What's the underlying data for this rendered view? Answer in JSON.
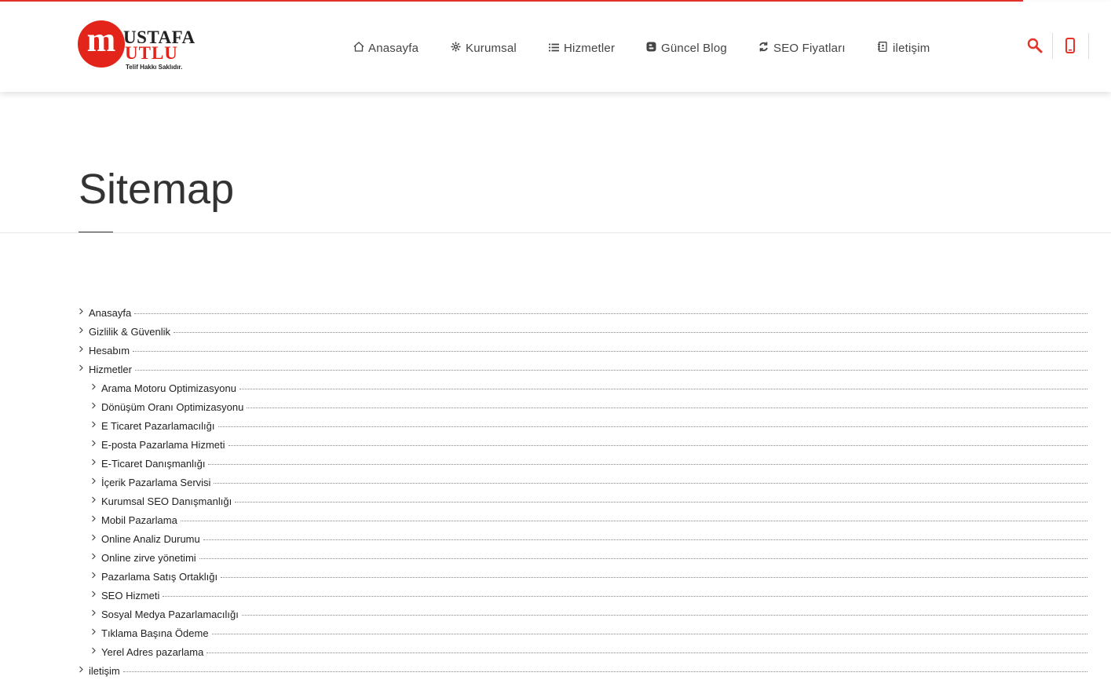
{
  "logo": {
    "mark_letter": "m",
    "name_top": "USTAFA",
    "name_bottom": "UTLU",
    "tagline": "Telif Hakkı Saklıdır."
  },
  "nav": [
    {
      "label": "Anasayfa",
      "icon": "home-icon"
    },
    {
      "label": "Kurumsal",
      "icon": "gear-icon"
    },
    {
      "label": "Hizmetler",
      "icon": "list-icon"
    },
    {
      "label": "Güncel Blog",
      "icon": "blogger-icon"
    },
    {
      "label": "SEO Fiyatları",
      "icon": "refresh-icon"
    },
    {
      "label": "iletişim",
      "icon": "contact-book-icon"
    }
  ],
  "header_icons": {
    "search": "search-icon",
    "phone": "phone-icon",
    "accent_color": "#e5332a"
  },
  "page_title": "Sitemap",
  "sitemap": [
    {
      "label": "Anasayfa",
      "level": 1
    },
    {
      "label": "Gizlilik & Güvenlik",
      "level": 1
    },
    {
      "label": "Hesabım",
      "level": 1
    },
    {
      "label": "Hizmetler",
      "level": 1
    },
    {
      "label": "Arama Motoru Optimizasyonu",
      "level": 2
    },
    {
      "label": "Dönüşüm Oranı Optimizasyonu",
      "level": 2
    },
    {
      "label": "E Ticaret Pazarlamacılığı",
      "level": 2
    },
    {
      "label": "E-posta Pazarlama Hizmeti",
      "level": 2
    },
    {
      "label": "E-Ticaret Danışmanlığı",
      "level": 2
    },
    {
      "label": "İçerik Pazarlama Servisi",
      "level": 2
    },
    {
      "label": "Kurumsal SEO Danışmanlığı",
      "level": 2
    },
    {
      "label": "Mobil Pazarlama",
      "level": 2
    },
    {
      "label": "Online Analiz Durumu",
      "level": 2
    },
    {
      "label": "Online zirve yönetimi",
      "level": 2
    },
    {
      "label": "Pazarlama Satış Ortaklığı",
      "level": 2
    },
    {
      "label": "SEO Hizmeti",
      "level": 2
    },
    {
      "label": "Sosyal Medya Pazarlamacılığı",
      "level": 2
    },
    {
      "label": "Tıklama Başına Ödeme",
      "level": 2
    },
    {
      "label": "Yerel Adres pazarlama",
      "level": 2
    },
    {
      "label": "iletişim",
      "level": 1
    }
  ]
}
